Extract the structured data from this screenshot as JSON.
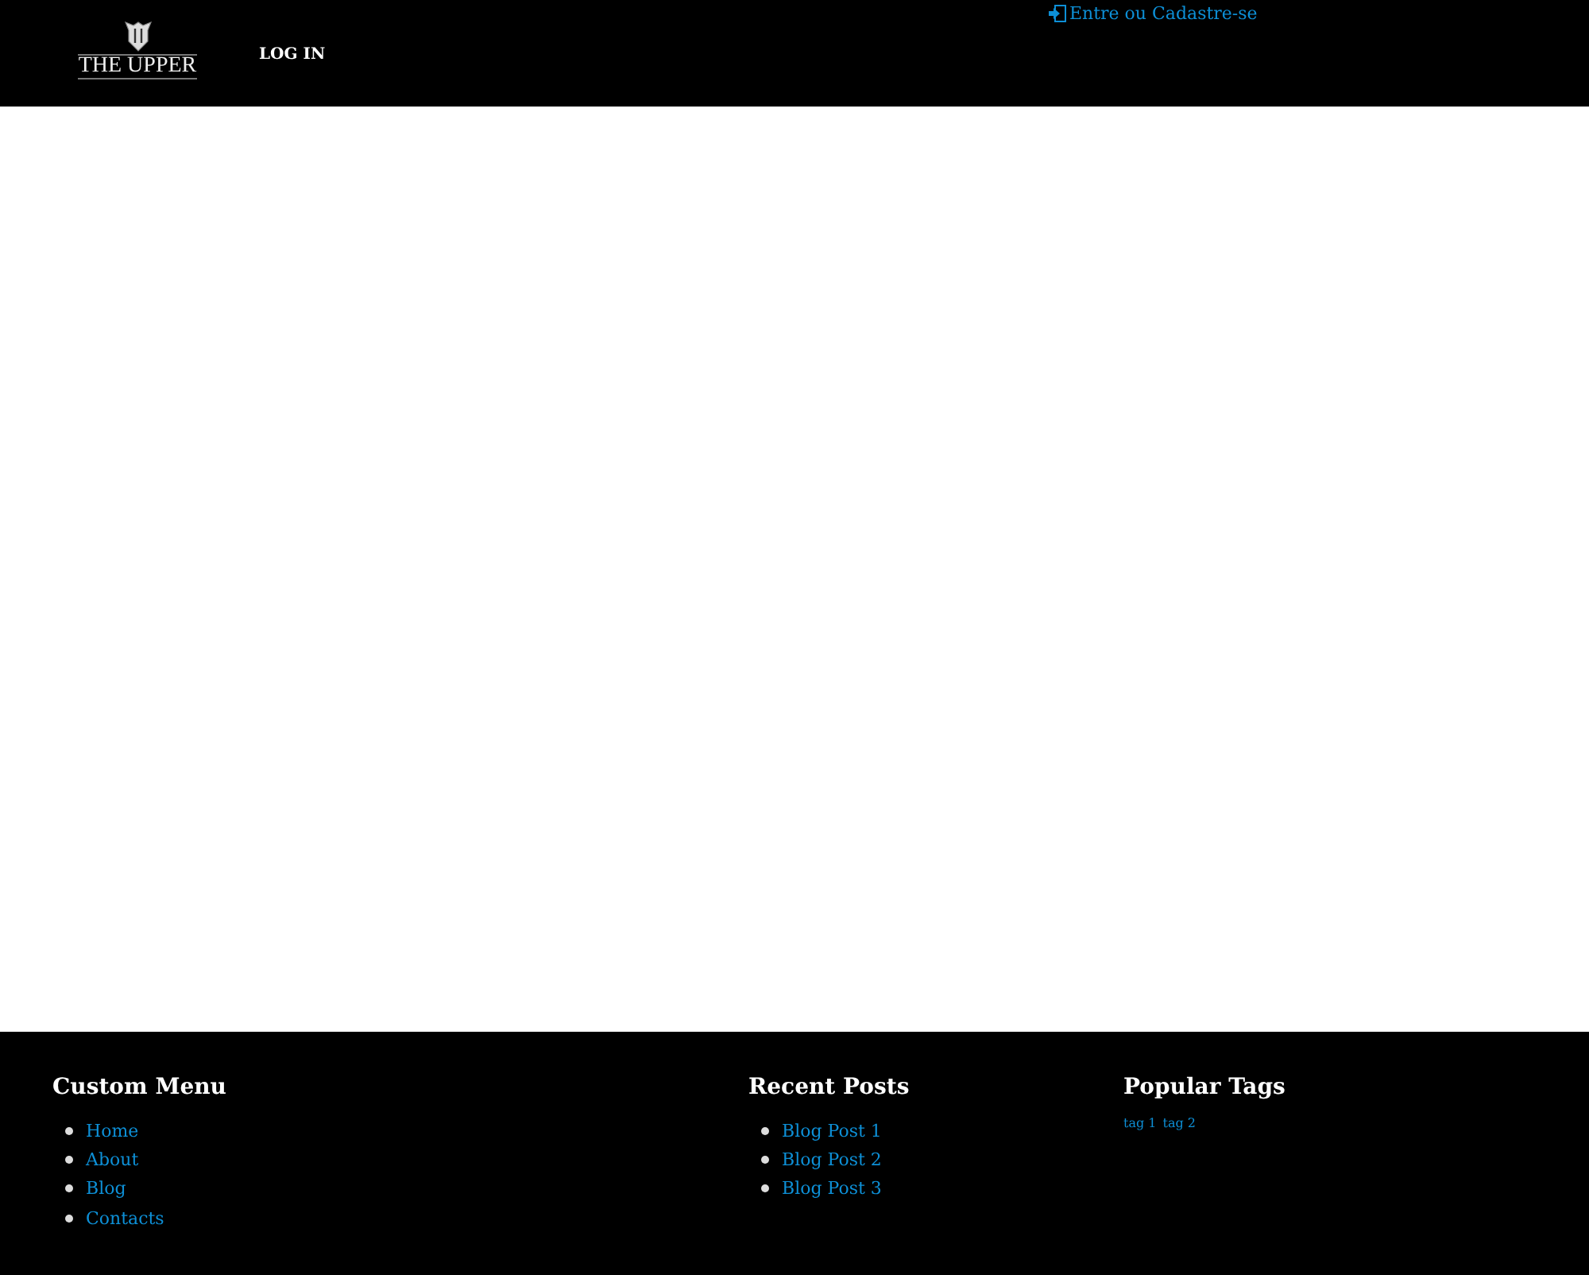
{
  "header": {
    "logo": "THE UPPER",
    "nav": [
      "LOG IN"
    ],
    "account_link": "Entre ou Cadastre-se"
  },
  "footer": {
    "columns": [
      {
        "title": "Custom Menu",
        "kind": "list",
        "items": [
          "Home",
          "About",
          "Blog",
          "Contacts"
        ]
      },
      {
        "title": "Recent Posts",
        "kind": "list",
        "items": [
          "Blog Post 1",
          "Blog Post 2",
          "Blog Post 3"
        ]
      },
      {
        "title": "Popular Tags",
        "kind": "tags",
        "items": [
          "tag 1",
          "tag 2"
        ]
      }
    ]
  }
}
